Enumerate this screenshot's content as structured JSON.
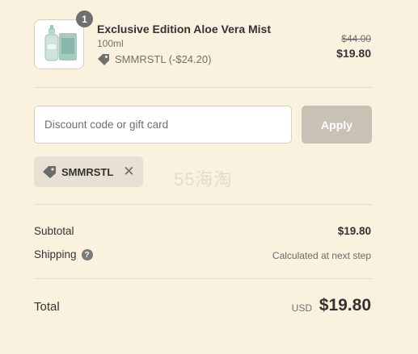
{
  "product": {
    "quantity": "1",
    "name": "Exclusive Edition Aloe Vera Mist",
    "variant": "100ml",
    "discount_text": "SMMRSTL (-$24.20)",
    "compare_price": "$44.00",
    "price": "$19.80"
  },
  "discount_form": {
    "placeholder": "Discount code or gift card",
    "apply_label": "Apply"
  },
  "applied_code": {
    "code": "SMMRSTL"
  },
  "watermark": "55海淘",
  "summary": {
    "subtotal_label": "Subtotal",
    "subtotal_value": "$19.80",
    "shipping_label": "Shipping",
    "shipping_help": "?",
    "shipping_value": "Calculated at next step"
  },
  "total": {
    "label": "Total",
    "currency": "USD",
    "amount": "$19.80"
  }
}
